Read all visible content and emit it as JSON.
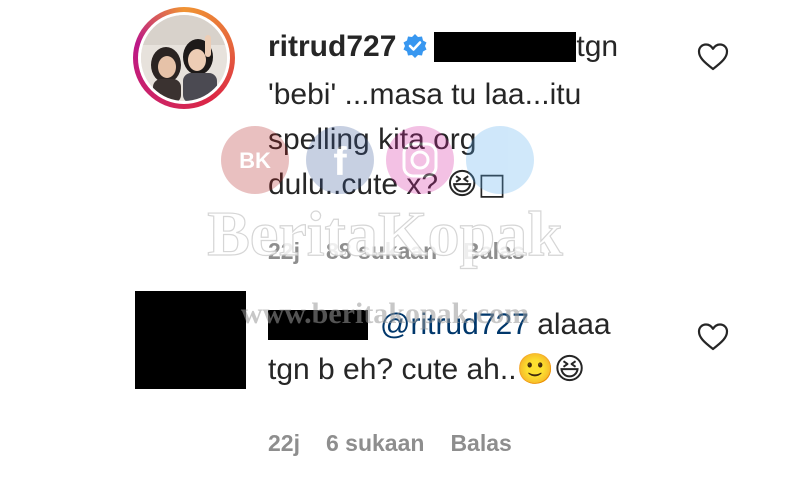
{
  "comment": {
    "username": "ritrud727",
    "line1_tail": "tgn",
    "line2": "'bebi' ...masa tu laa...itu",
    "line3": "spelling kita org",
    "line4_text": "dulu..cute x? ",
    "line4_emoji": "😆□",
    "time": "22j",
    "likes": "88 sukaan",
    "reply_label": "Balas"
  },
  "reply": {
    "mention": "@ritrud727",
    "line1_tail": " alaaa",
    "line2_text": "tgn b eh? cute ah..",
    "line2_emoji": "🙂😆",
    "time": "22j",
    "likes": "6 sukaan",
    "reply_label": "Balas"
  },
  "watermark": {
    "logo_text": "BK",
    "main": "BeritaKopak",
    "url": "www.beritakopak.com"
  },
  "colors": {
    "text": "#262626",
    "muted": "#8e8e8e",
    "mention": "#00376b",
    "verified": "#3897f0"
  }
}
